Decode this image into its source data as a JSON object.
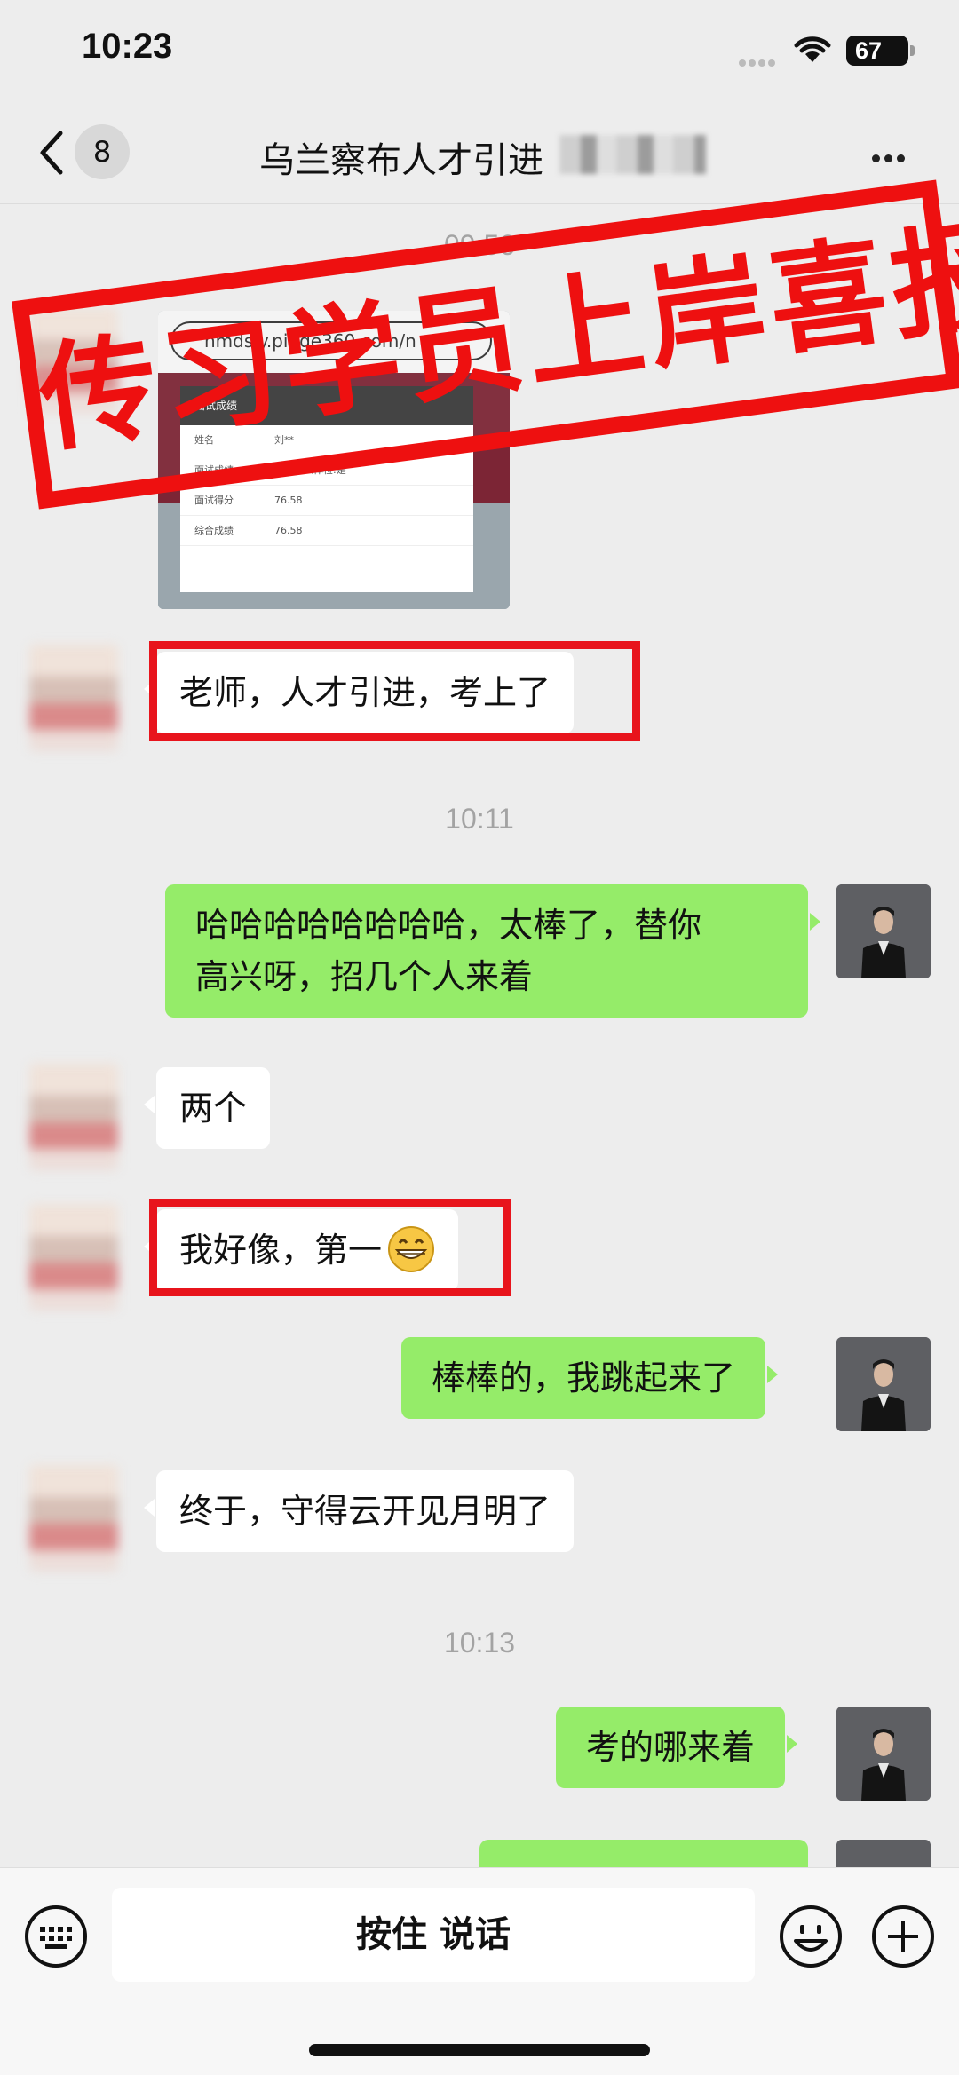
{
  "status_bar": {
    "time": "10:23",
    "battery": "67"
  },
  "nav": {
    "unread_count": "8",
    "title": "乌兰察布人才引进"
  },
  "timestamps": {
    "t1": "09:56",
    "t2": "10:11",
    "t3": "10:13"
  },
  "image_message": {
    "url_text": "nmdsjy.pinge360.com/n",
    "card_header": "面试成绩",
    "rows": [
      {
        "label": "姓名",
        "value": "刘**"
      },
      {
        "label": "面试成绩",
        "value": "是否进入体检:是"
      },
      {
        "label": "面试得分",
        "value": "76.58"
      },
      {
        "label": "综合成绩",
        "value": "76.58"
      }
    ]
  },
  "stamp": {
    "text": "传习学员上岸喜报",
    "color": "#ee1010"
  },
  "messages": {
    "m1": "老师，人才引进，考上了",
    "m2_line1": "哈哈哈哈哈哈哈哈，太棒了，替你",
    "m2_line2": "高兴呀，招几个人来着",
    "m3": "两个",
    "m4": "我好像，第一",
    "m5": "棒棒的，我跳起来了",
    "m6": "终于，守得云开见月明了",
    "m7": "考的哪来着"
  },
  "input_bar": {
    "hold_to_talk": "按住 说话"
  },
  "colors": {
    "outgoing_bubble": "#95ec69",
    "incoming_bubble": "#ffffff",
    "highlight": "#e8141c",
    "background": "#ededed"
  }
}
